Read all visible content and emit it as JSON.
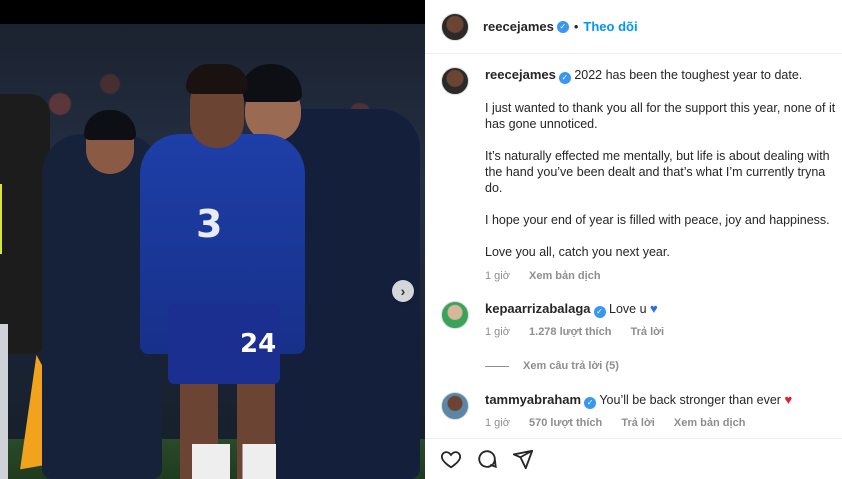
{
  "post": {
    "username": "reecejames",
    "follow_label": "Theo dõi",
    "separator": "•",
    "verified_icon": "✓",
    "carousel_next_icon": "›",
    "photo_texts": {
      "sponsor": "3",
      "number": "24"
    }
  },
  "caption": {
    "username": "reecejames",
    "paragraphs": [
      "2022 has been the toughest year to date.",
      "I just wanted to thank you all for the support this year, none of it has gone unnoticed.",
      "It’s naturally effected me mentally, but life is about dealing with the hand you’ve been dealt and that’s what I’m currently tryna do.",
      "I hope your end of year is filled with peace, joy and happiness.",
      "Love you all, catch you next year."
    ],
    "time": "1 giờ",
    "translate_label": "Xem bản dịch"
  },
  "comments": [
    {
      "username": "kepaarrizabalaga",
      "text": "Love u",
      "emoji": "♥",
      "time": "1 giờ",
      "likes": "1.278 lượt thích",
      "reply_label": "Trả lời",
      "view_replies": "Xem câu trả lời (5)"
    },
    {
      "username": "tammyabraham",
      "text": "You’ll be back stronger than ever",
      "emoji": "♥",
      "time": "1 giờ",
      "likes": "570 lượt thích",
      "reply_label": "Trả lời",
      "translate_label": "Xem bản dịch"
    }
  ],
  "colors": {
    "accent": "#0095f6",
    "muted": "#8e8e8e",
    "verified": "#3897f0"
  },
  "icons": [
    "heart-icon",
    "comment-icon",
    "share-icon",
    "verified-icon",
    "chevron-right-icon"
  ]
}
